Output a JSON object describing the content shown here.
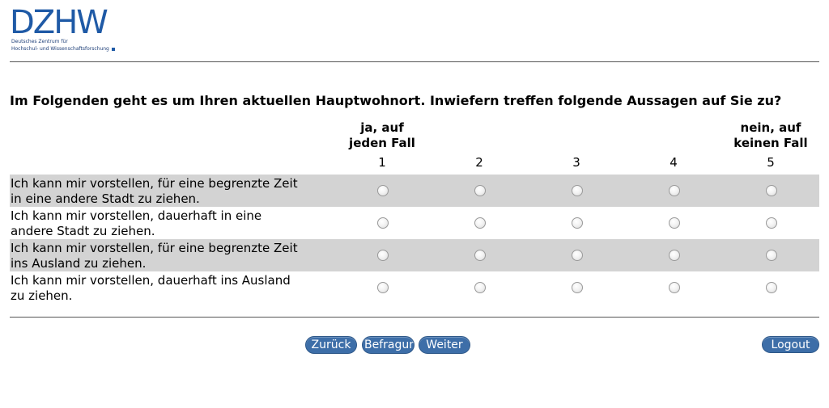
{
  "logo": {
    "mark": "DZHW",
    "line1": "Deutsches Zentrum für",
    "line2": "Hochschul- und Wissenschaftsforschung"
  },
  "question": "Im Folgenden geht es um Ihren aktuellen Hauptwohnort. Inwiefern treffen folgende Aussagen auf Sie zu?",
  "scale": {
    "low_label_line1": "ja, auf",
    "low_label_line2": "jeden Fall",
    "high_label_line1": "nein, auf",
    "high_label_line2": "keinen Fall",
    "points": [
      "1",
      "2",
      "3",
      "4",
      "5"
    ]
  },
  "items": [
    {
      "line1": "Ich kann mir vorstellen, für eine begrenzte Zeit",
      "line2": "in eine andere Stadt zu ziehen."
    },
    {
      "line1": "Ich kann mir vorstellen, dauerhaft in eine",
      "line2": "andere Stadt zu ziehen."
    },
    {
      "line1": "Ich kann mir vorstellen, für eine begrenzte Zeit",
      "line2": "ins Ausland zu ziehen."
    },
    {
      "line1": "Ich kann mir vorstellen, dauerhaft ins Ausland",
      "line2": "zu ziehen."
    }
  ],
  "buttons": {
    "back": "Zurück",
    "survey": "Befragung",
    "next": "Weiter",
    "logout": "Logout"
  },
  "colors": {
    "accent": "#3d6ea8",
    "row_shade": "#d3d3d3",
    "logo": "#1f5aa6"
  }
}
